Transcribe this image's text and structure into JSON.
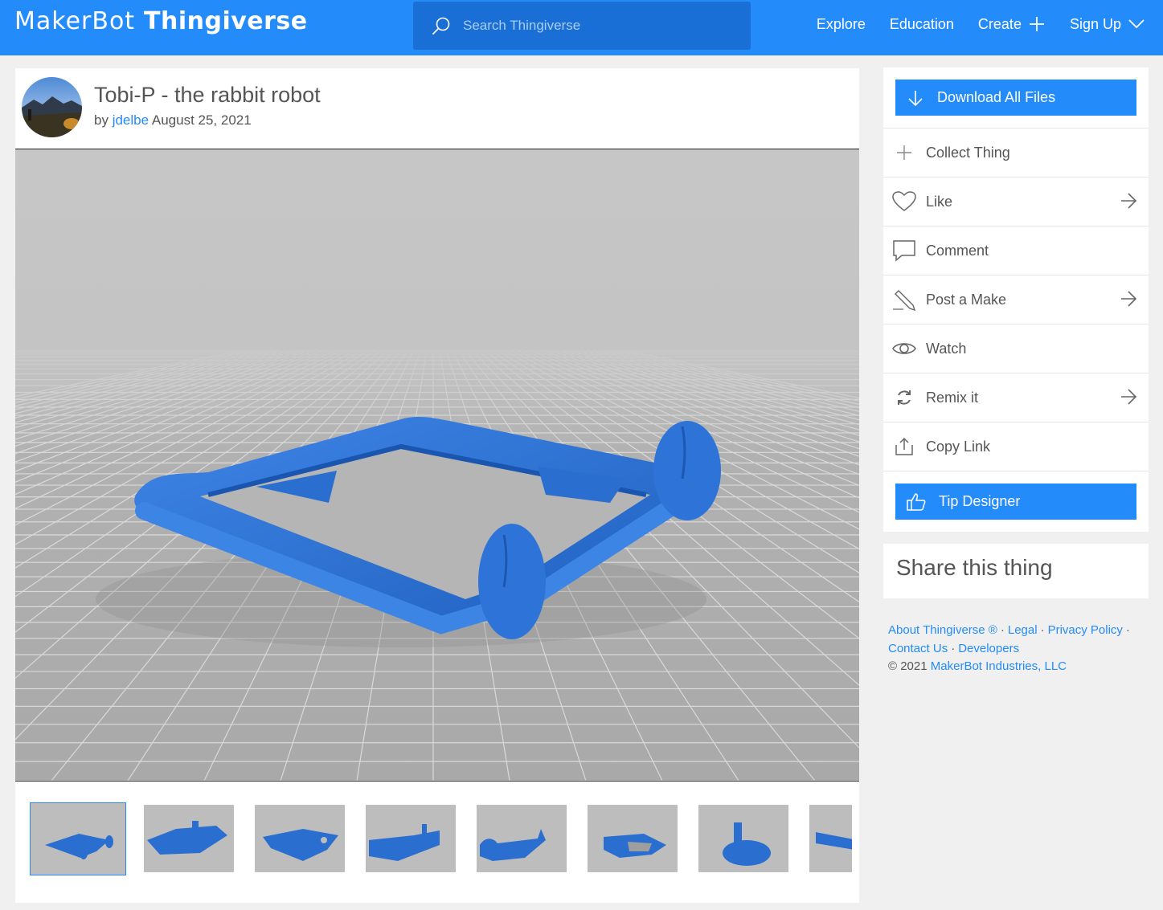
{
  "header": {
    "logo_bold": "MakerBot",
    "logo_rest": "Thingiverse",
    "search_placeholder": "Search Thingiverse",
    "nav": {
      "explore": "Explore",
      "education": "Education",
      "create": "Create",
      "signup": "Sign Up"
    }
  },
  "thing": {
    "title": "Tobi-P - the rabbit robot",
    "by_prefix": "by",
    "author": "jdelbe",
    "date": "August 25, 2021",
    "thumbnail_count": 8,
    "active_thumbnail": 1
  },
  "sidebar": {
    "download_label": "Download All Files",
    "actions": {
      "collect": "Collect Thing",
      "like": "Like",
      "comment": "Comment",
      "post_make": "Post a Make",
      "watch": "Watch",
      "remix": "Remix it",
      "copy_link": "Copy Link"
    },
    "tip_label": "Tip Designer",
    "share_title": "Share this thing"
  },
  "footer": {
    "about": "About Thingiverse ®",
    "legal": "Legal",
    "privacy": "Privacy Policy",
    "contact": "Contact Us",
    "developers": "Developers",
    "copyright_prefix": "© 2021",
    "company": "MakerBot Industries, LLC",
    "separator": "·"
  },
  "colors": {
    "brand_blue": "#248bfb",
    "search_bg": "#1a6fd6",
    "model_blue": "#2a6fd0",
    "page_bg": "#f0f0f0"
  }
}
